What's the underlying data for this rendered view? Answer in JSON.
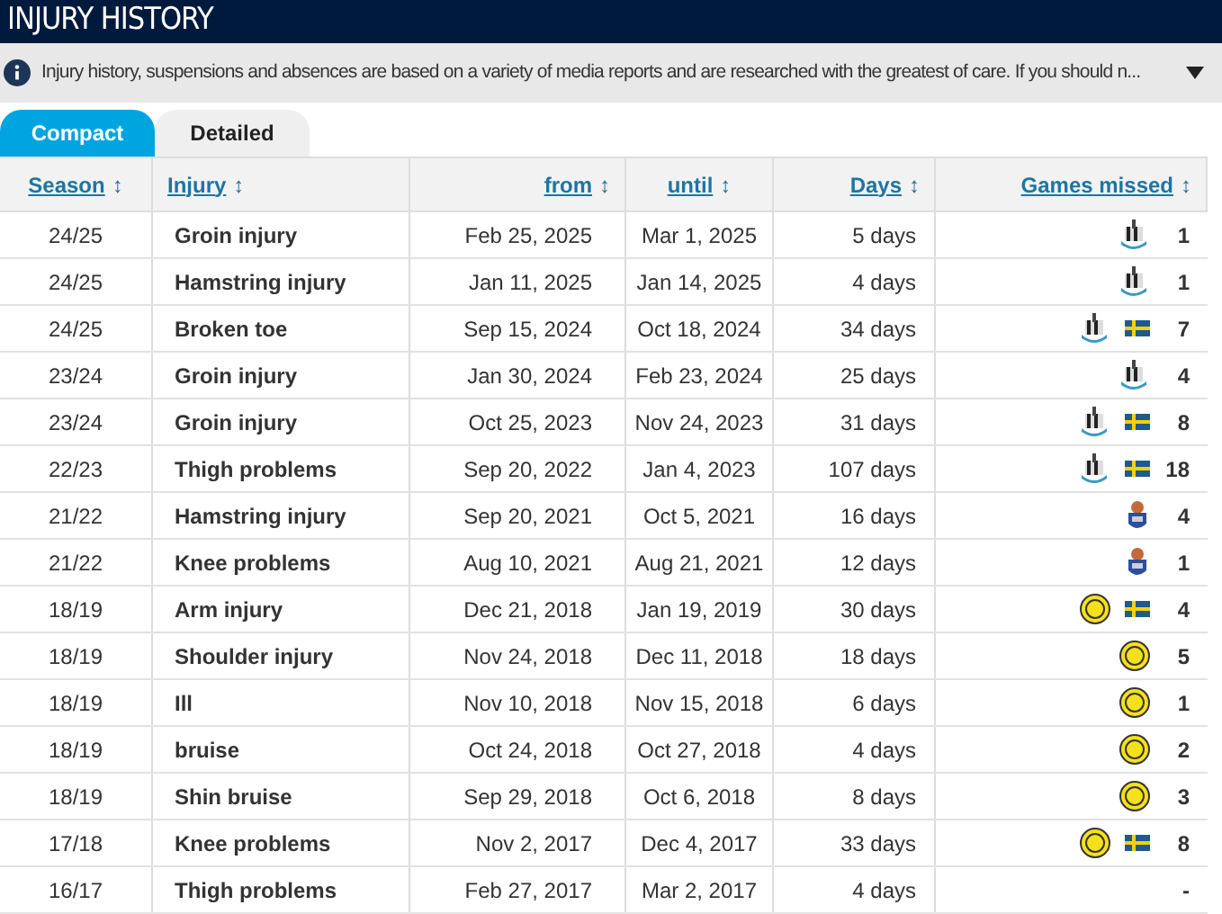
{
  "title": "INJURY HISTORY",
  "notice": "Injury history, suspensions and absences are based on a variety of media reports and are researched with the greatest of care. If you should n...",
  "tabs": [
    {
      "label": "Compact",
      "selected": true
    },
    {
      "label": "Detailed",
      "selected": false
    }
  ],
  "columns": [
    {
      "label": "Season",
      "sort": "↕"
    },
    {
      "label": "Injury",
      "sort": "↕"
    },
    {
      "label": "from",
      "sort": "↕"
    },
    {
      "label": "until",
      "sort": "↕"
    },
    {
      "label": "Days",
      "sort": "↕"
    },
    {
      "label": "Games missed",
      "sort": "↕"
    }
  ],
  "rows": [
    {
      "season": "24/25",
      "injury": "Groin injury",
      "from": "Feb 25, 2025",
      "until": "Mar 1, 2025",
      "days": "5 days",
      "clubs": [
        {
          "kind": "striped"
        }
      ],
      "flag": false,
      "games": "1"
    },
    {
      "season": "24/25",
      "injury": "Hamstring injury",
      "from": "Jan 11, 2025",
      "until": "Jan 14, 2025",
      "days": "4 days",
      "clubs": [
        {
          "kind": "striped"
        }
      ],
      "flag": false,
      "games": "1"
    },
    {
      "season": "24/25",
      "injury": "Broken toe",
      "from": "Sep 15, 2024",
      "until": "Oct 18, 2024",
      "days": "34 days",
      "clubs": [
        {
          "kind": "striped"
        }
      ],
      "flag": true,
      "games": "7"
    },
    {
      "season": "23/24",
      "injury": "Groin injury",
      "from": "Jan 30, 2024",
      "until": "Feb 23, 2024",
      "days": "25 days",
      "clubs": [
        {
          "kind": "striped"
        }
      ],
      "flag": false,
      "games": "4"
    },
    {
      "season": "23/24",
      "injury": "Groin injury",
      "from": "Oct 25, 2023",
      "until": "Nov 24, 2023",
      "days": "31 days",
      "clubs": [
        {
          "kind": "striped"
        }
      ],
      "flag": true,
      "games": "8"
    },
    {
      "season": "22/23",
      "injury": "Thigh problems",
      "from": "Sep 20, 2022",
      "until": "Jan 4, 2023",
      "days": "107 days",
      "clubs": [
        {
          "kind": "striped"
        }
      ],
      "flag": true,
      "games": "18"
    },
    {
      "season": "21/22",
      "injury": "Hamstring injury",
      "from": "Sep 20, 2021",
      "until": "Oct 5, 2021",
      "days": "16 days",
      "clubs": [
        {
          "kind": "shield"
        }
      ],
      "flag": false,
      "games": "4"
    },
    {
      "season": "21/22",
      "injury": "Knee problems",
      "from": "Aug 10, 2021",
      "until": "Aug 21, 2021",
      "days": "12 days",
      "clubs": [
        {
          "kind": "shield"
        }
      ],
      "flag": false,
      "games": "1"
    },
    {
      "season": "18/19",
      "injury": "Arm injury",
      "from": "Dec 21, 2018",
      "until": "Jan 19, 2019",
      "days": "30 days",
      "clubs": [
        {
          "kind": "round"
        }
      ],
      "flag": true,
      "games": "4"
    },
    {
      "season": "18/19",
      "injury": "Shoulder injury",
      "from": "Nov 24, 2018",
      "until": "Dec 11, 2018",
      "days": "18 days",
      "clubs": [
        {
          "kind": "round"
        }
      ],
      "flag": false,
      "games": "5"
    },
    {
      "season": "18/19",
      "injury": "Ill",
      "from": "Nov 10, 2018",
      "until": "Nov 15, 2018",
      "days": "6 days",
      "clubs": [
        {
          "kind": "round"
        }
      ],
      "flag": false,
      "games": "1"
    },
    {
      "season": "18/19",
      "injury": "bruise",
      "from": "Oct 24, 2018",
      "until": "Oct 27, 2018",
      "days": "4 days",
      "clubs": [
        {
          "kind": "round"
        }
      ],
      "flag": false,
      "games": "2"
    },
    {
      "season": "18/19",
      "injury": "Shin bruise",
      "from": "Sep 29, 2018",
      "until": "Oct 6, 2018",
      "days": "8 days",
      "clubs": [
        {
          "kind": "round"
        }
      ],
      "flag": false,
      "games": "3"
    },
    {
      "season": "17/18",
      "injury": "Knee problems",
      "from": "Nov 2, 2017",
      "until": "Dec 4, 2017",
      "days": "33 days",
      "clubs": [
        {
          "kind": "round"
        }
      ],
      "flag": true,
      "games": "8"
    },
    {
      "season": "16/17",
      "injury": "Thigh problems",
      "from": "Feb 27, 2017",
      "until": "Mar 2, 2017",
      "days": "4 days",
      "clubs": [],
      "flag": false,
      "games": "-"
    }
  ]
}
